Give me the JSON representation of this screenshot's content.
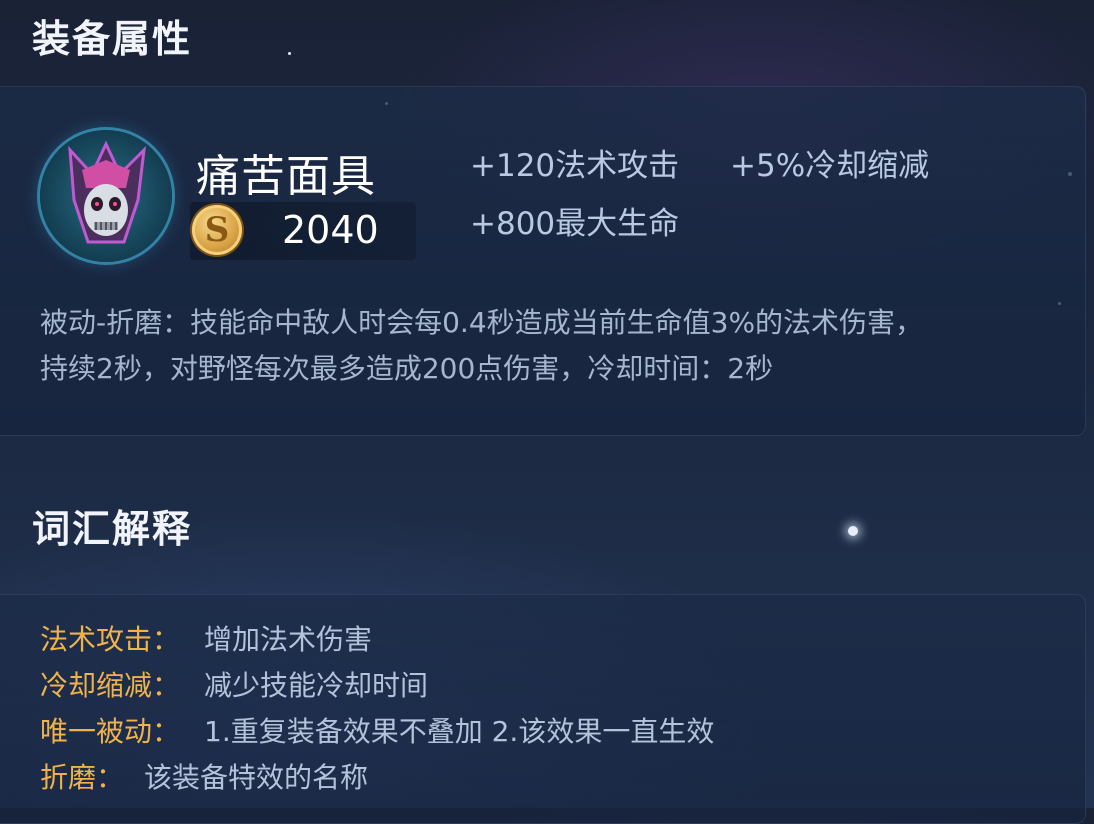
{
  "sections": {
    "attributes_title": "装备属性",
    "glossary_title": "词汇解释"
  },
  "item": {
    "name": "痛苦面具",
    "price": "2040",
    "icon": "skull-mask-icon",
    "currency_icon": "gold-coin-icon",
    "currency_glyph": "S",
    "stats": [
      "+120法术攻击",
      "+5%冷却缩减",
      "+800最大生命"
    ],
    "passive_line1": "被动-折磨：技能命中敌人时会每0.4秒造成当前生命值3%的法术伤害，",
    "passive_line2": "持续2秒，对野怪每次最多造成200点伤害，冷却时间：2秒"
  },
  "glossary": [
    {
      "term": "法术攻击：",
      "definition": "增加法术伤害"
    },
    {
      "term": "冷却缩减：",
      "definition": "减少技能冷却时间"
    },
    {
      "term": "唯一被动：",
      "definition": "1.重复装备效果不叠加 2.该效果一直生效"
    },
    {
      "term": "折磨：",
      "definition": "该装备特效的名称"
    }
  ],
  "colors": {
    "term": "#f0b24a",
    "definition": "#b4c3da",
    "stat": "#b9c9e2",
    "title": "#f1f4fa"
  }
}
